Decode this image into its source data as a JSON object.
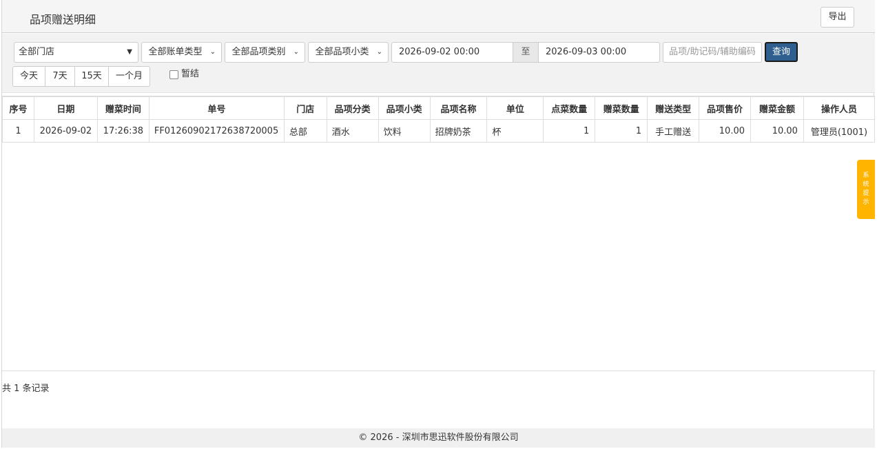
{
  "header": {
    "title": "品项赠送明细",
    "export_label": "导出"
  },
  "filters": {
    "store": "全部门店",
    "bill_type": "全部账单类型",
    "item_category": "全部品项类别",
    "item_subcategory": "全部品项小类",
    "start_date": "2026-09-02 00:00",
    "to_label": "至",
    "end_date": "2026-09-03 00:00",
    "search_placeholder": "品项/助记码/辅助编码",
    "query_label": "查询",
    "ranges": [
      "今天",
      "7天",
      "15天",
      "一个月"
    ],
    "pending_label": "暂结"
  },
  "table": {
    "columns": [
      "序号",
      "日期",
      "赠菜时间",
      "单号",
      "门店",
      "品项分类",
      "品项小类",
      "品项名称",
      "单位",
      "点菜数量",
      "赠菜数量",
      "赠送类型",
      "品项售价",
      "赠菜金额",
      "操作人员"
    ],
    "rows": [
      [
        "1",
        "2026-09-02",
        "17:26:38",
        "FF0126090217263872000​5",
        "总部",
        "酒水",
        "饮料",
        "招牌奶茶",
        "杯",
        "1",
        "1",
        "手工赠送",
        "10.00",
        "10.00",
        "管理员(1001)"
      ]
    ]
  },
  "footer": {
    "record_count": "共 1 条记录",
    "copyright": "© 2026 - 深圳市思迅软件股份有限公司"
  },
  "side_tip": {
    "chars": [
      "系",
      "统",
      "提",
      "示"
    ]
  },
  "colors": {
    "query_button": "#2f5f8f",
    "side_tip": "#ffb400"
  }
}
